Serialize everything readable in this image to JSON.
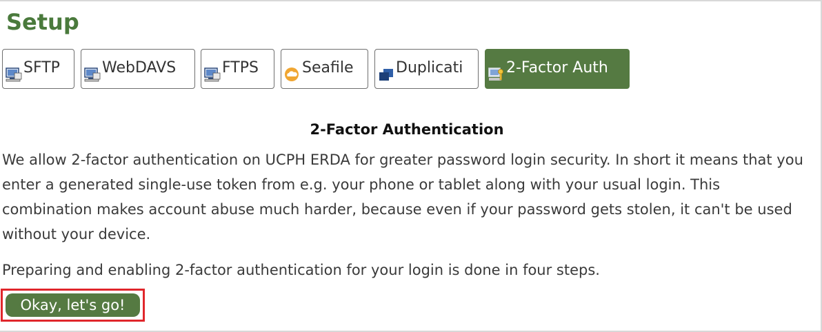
{
  "header": {
    "title": "Setup"
  },
  "tabs": [
    {
      "id": "sftp",
      "label": "SFTP",
      "icon": "computer-icon",
      "active": false
    },
    {
      "id": "webdavs",
      "label": "WebDAVS",
      "icon": "computer-icon",
      "active": false
    },
    {
      "id": "ftps",
      "label": "FTPS",
      "icon": "computer-icon",
      "active": false
    },
    {
      "id": "seafile",
      "label": "Seafile",
      "icon": "seafile-cloud-icon",
      "active": false
    },
    {
      "id": "duplicati",
      "label": "Duplicati",
      "icon": "duplicati-icon",
      "active": false
    },
    {
      "id": "twofactor",
      "label": "2-Factor Auth",
      "icon": "computer-key-icon",
      "active": true
    }
  ],
  "content": {
    "section_title": "2-Factor Authentication",
    "intro": "We allow 2-factor authentication on UCPH ERDA  for greater password login security. In short it means that you enter a generated single-use token from e.g. your phone or tablet along with your usual login. This combination makes account abuse much harder, because even if your password gets stolen, it can't be used without your device.",
    "steps_note": "Preparing and enabling 2-factor authentication for your login is done in four steps.",
    "go_button_label": "Okay, let's go!"
  },
  "colors": {
    "accent_green": "#557a42",
    "title_green": "#4a7a3c",
    "highlight_red": "#e0262b"
  }
}
